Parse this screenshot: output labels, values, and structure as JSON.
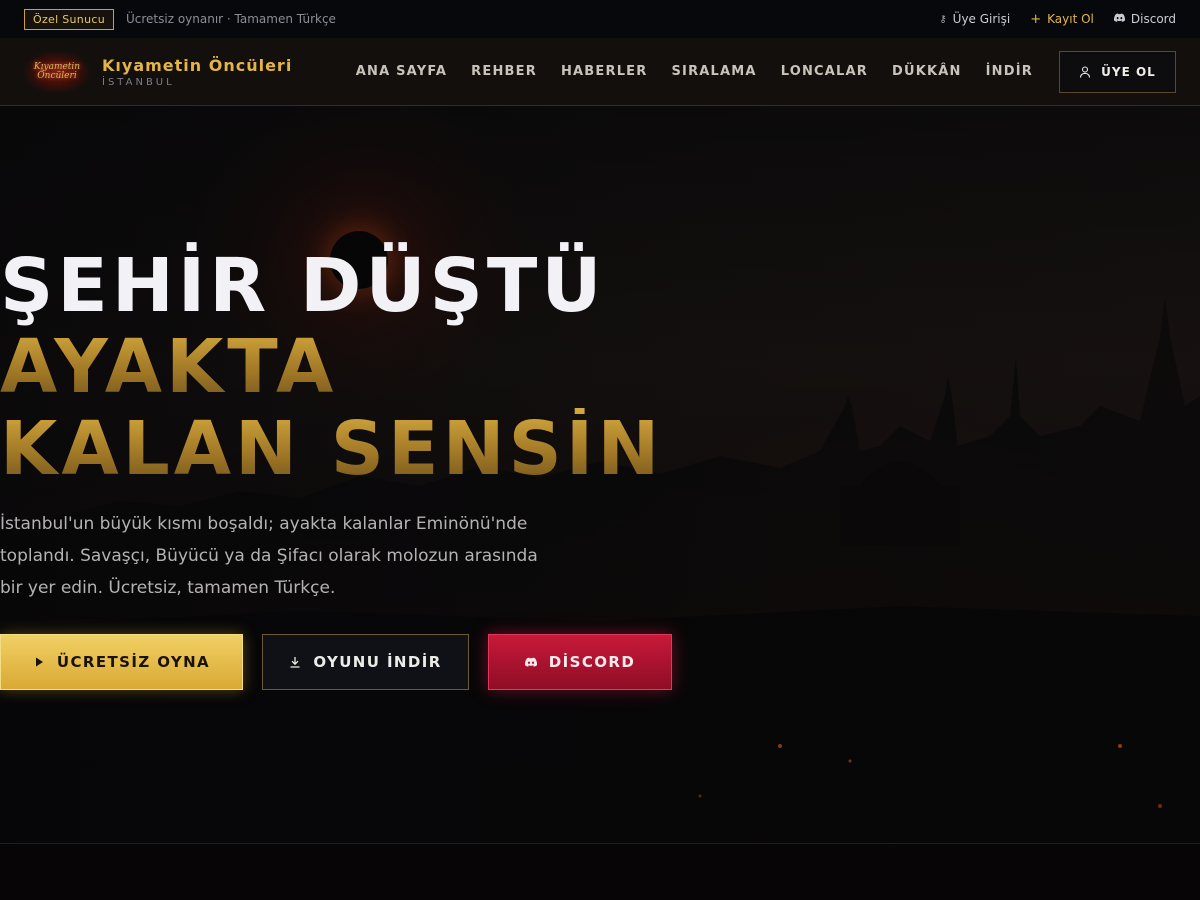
{
  "topbar": {
    "badge": "Özel Sunucu",
    "tagline": "Ücretsiz oynanır · Tamamen Türkçe",
    "links": {
      "login": "Üye Girişi",
      "register": "Kayıt Ol",
      "discord": "Discord"
    }
  },
  "brand": {
    "logo_text": "Kıyametin Öncüleri",
    "name": "Kıyametin Öncüleri",
    "city": "İSTANBUL"
  },
  "nav": {
    "items": [
      "ANA SAYFA",
      "REHBER",
      "HABERLER",
      "SIRALAMA",
      "LONCALAR",
      "DÜKKÂN",
      "İNDİR"
    ],
    "signup": "ÜYE OL"
  },
  "hero": {
    "line1": "ŞEHİR DÜŞTÜ",
    "line2": "AYAKTA",
    "line3": "KALAN SENSİN",
    "description": "İstanbul'un büyük kısmı boşaldı; ayakta kalanlar Eminönü'nde toplandı. Savaşçı, Büyücü ya da Şifacı olarak molozun arasında bir yer edin. Ücretsiz, tamamen Türkçe.",
    "buttons": {
      "play": "ÜCRETSİZ OYNA",
      "download": "OYUNU İNDİR",
      "discord": "DİSCORD"
    }
  },
  "colors": {
    "gold": "#e3b447",
    "discord_red": "#c8193a",
    "background": "#060608"
  },
  "icons": {
    "login": "key-icon",
    "register": "plus-icon",
    "discord": "discord-icon",
    "signup": "user-icon",
    "play": "play-icon",
    "download": "download-icon"
  }
}
